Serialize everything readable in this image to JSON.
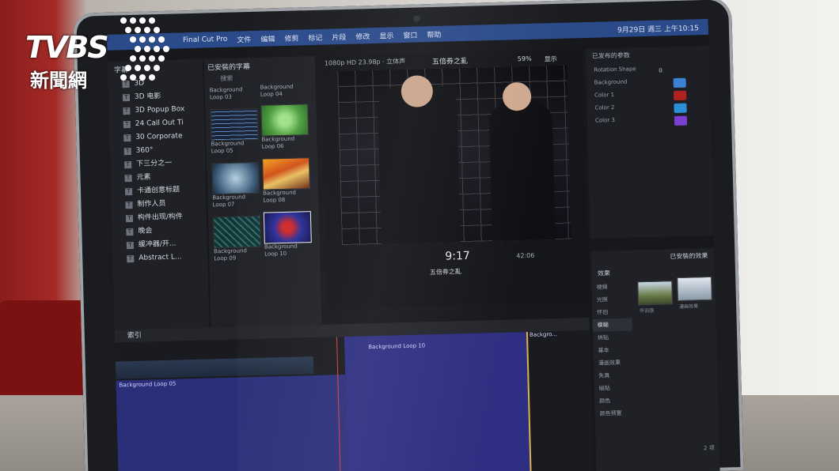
{
  "logo": {
    "letters": "TVBS",
    "subtitle": "新聞網"
  },
  "menubar": {
    "app": "Final Cut Pro",
    "items": [
      "文件",
      "编辑",
      "修剪",
      "标记",
      "片段",
      "修改",
      "显示",
      "窗口",
      "帮助"
    ],
    "clock": "9月29日 週三 上午10:15"
  },
  "browser_panel": {
    "title": "已安裝的字幕",
    "search_placeholder": "搜索",
    "category_header": "字幕",
    "categories": [
      "3D",
      "3D 电影",
      "3D Popup Box",
      "24 Call Out Ti",
      "30 Corporate",
      "360°",
      "下三分之一",
      "元素",
      "卡通创意标题",
      "制作人员",
      "构件出现/构件",
      "晚会",
      "缓冲器/开...",
      "Abstract L..."
    ],
    "thumbnails": [
      {
        "label": "Background Loop 03"
      },
      {
        "label": "Background Loop 04"
      },
      {
        "label": "Background Loop 05"
      },
      {
        "label": "Background Loop 06"
      },
      {
        "label": "Background Loop 07"
      },
      {
        "label": "Background Loop 08"
      },
      {
        "label": "Background Loop 09"
      },
      {
        "label": "Background Loop 10"
      }
    ]
  },
  "viewer": {
    "format": "1080p HD 23.98p · 立体声",
    "title": "五倍券之亂",
    "zoom": "59%",
    "display": "显示",
    "timecode": "9:17",
    "duration": "42:06",
    "project": "五倍券之亂"
  },
  "inspector": {
    "header": "已发布的参数",
    "rows": [
      "Rotation Shape",
      "Background",
      "Color 1",
      "Color 2",
      "Color 3"
    ],
    "swatches": [
      "#3b82d6",
      "#b32020",
      "#2a8fd8",
      "#7a3fd0"
    ],
    "value": "0"
  },
  "timeline": {
    "index_label": "索引",
    "clip_a": "Background Loop 05",
    "clip_b": "Background Loop 10",
    "clip_c": "Backgro..."
  },
  "effects_panel": {
    "title": "效果",
    "installed": "已安裝的效果",
    "categories": [
      "視頻",
      "光照",
      "怀旧",
      "模糊",
      "拼贴",
      "基本",
      "漫画效果",
      "失真",
      "磁贴",
      "颜色",
      "颜色预置"
    ],
    "selected_category": "模糊",
    "thumbs": [
      "怀旧感",
      "漫画效果"
    ],
    "count": "2 项"
  }
}
